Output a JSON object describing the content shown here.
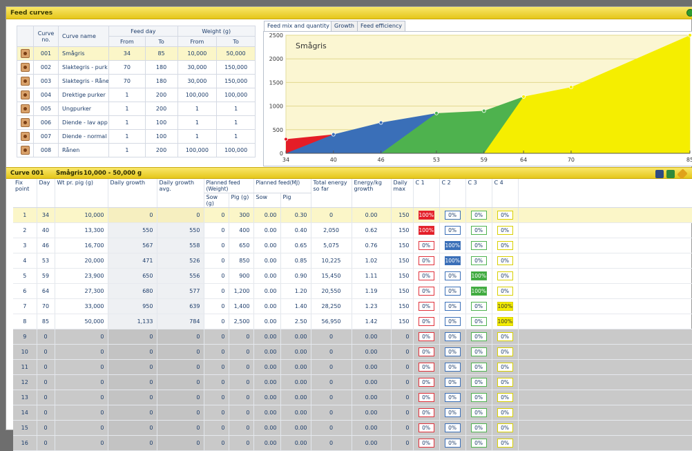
{
  "window": {
    "title": "Feed curves"
  },
  "curves_table": {
    "headers": {
      "curve_no": "Curve no.",
      "curve_name": "Curve name",
      "feed_day": "Feed day",
      "weight": "Weight (g)",
      "from": "From",
      "to": "To"
    },
    "rows": [
      {
        "no": "001",
        "name": "Smågris",
        "from_day": "34",
        "to_day": "85",
        "from_w": "10,000",
        "to_w": "50,000"
      },
      {
        "no": "002",
        "name": "Slaktegris - purk",
        "from_day": "70",
        "to_day": "180",
        "from_w": "30,000",
        "to_w": "150,000"
      },
      {
        "no": "003",
        "name": "Slaktegris - Råne",
        "from_day": "70",
        "to_day": "180",
        "from_w": "30,000",
        "to_w": "150,000"
      },
      {
        "no": "004",
        "name": "Drektige purker",
        "from_day": "1",
        "to_day": "200",
        "from_w": "100,000",
        "to_w": "100,000"
      },
      {
        "no": "005",
        "name": "Ungpurker",
        "from_day": "1",
        "to_day": "200",
        "from_w": "1",
        "to_w": "1"
      },
      {
        "no": "006",
        "name": "Diende - lav app",
        "from_day": "1",
        "to_day": "100",
        "from_w": "1",
        "to_w": "1"
      },
      {
        "no": "007",
        "name": "Diende - normal",
        "from_day": "1",
        "to_day": "100",
        "from_w": "1",
        "to_w": "1"
      },
      {
        "no": "008",
        "name": "Rånen",
        "from_day": "1",
        "to_day": "200",
        "from_w": "100,000",
        "to_w": "100,000"
      }
    ]
  },
  "tabs": [
    "Feed mix and quantity",
    "Growth",
    "Feed efficiency"
  ],
  "chart_data": {
    "type": "area",
    "title": "Smågris",
    "x_ticks": [
      "34",
      "40",
      "46",
      "53",
      "59",
      "64",
      "70",
      "85"
    ],
    "y_ticks": [
      "0",
      "500",
      "1000",
      "1500",
      "2000",
      "2500"
    ],
    "xlim": [
      34,
      85
    ],
    "ylim": [
      0,
      2500
    ],
    "x": [
      34,
      40,
      46,
      53,
      59,
      64,
      70,
      85
    ],
    "total": [
      300,
      400,
      650,
      850,
      900,
      1200,
      1400,
      2500
    ],
    "series": [
      {
        "values": [
          300,
          400,
          0,
          0,
          0,
          0,
          0,
          0
        ],
        "color": "#e41d27"
      },
      {
        "values": [
          0,
          400,
          650,
          850,
          0,
          0,
          0,
          0
        ],
        "color": "#3a6fb8"
      },
      {
        "values": [
          0,
          0,
          0,
          850,
          900,
          1200,
          0,
          0
        ],
        "color": "#4eb24e"
      },
      {
        "values": [
          0,
          0,
          0,
          0,
          0,
          1200,
          1400,
          2500
        ],
        "color": "#f5ee00"
      }
    ]
  },
  "section": {
    "curve_label": "Curve 001",
    "name": "Smågris",
    "range": "10,000 - 50,000 g"
  },
  "grid": {
    "headers": {
      "fix_point": "Fix point",
      "day": "Day",
      "wt": "Wt pr. pig (g)",
      "daily_growth": "Daily growth",
      "daily_growth_avg": "Daily growth avg.",
      "planned_weight": "Planned feed (Weight)",
      "sow_g": "Sow (g)",
      "pig_g": "Pig (g)",
      "planned_mj": "Planned feed(MJ)",
      "sow": "Sow",
      "pig": "Pig",
      "total_energy": "Total energy so far",
      "energy_kg": "Energy/kg growth",
      "daily_max": "Daily max",
      "c1": "C 1",
      "c2": "C 2",
      "c3": "C 3",
      "c4": "C 4"
    },
    "rows": [
      {
        "fp": "1",
        "day": "34",
        "wt": "10,000",
        "dg": "0",
        "dga": "0",
        "sowg": "0",
        "pigg": "300",
        "sowmj": "0.00",
        "pigmj": "0.30",
        "te": "0",
        "ekg": "0.00",
        "dmax": "150",
        "c": [
          "100%",
          "0%",
          "0%",
          "0%"
        ]
      },
      {
        "fp": "2",
        "day": "40",
        "wt": "13,300",
        "dg": "550",
        "dga": "550",
        "sowg": "0",
        "pigg": "400",
        "sowmj": "0.00",
        "pigmj": "0.40",
        "te": "2,050",
        "ekg": "0.62",
        "dmax": "150",
        "c": [
          "100%",
          "0%",
          "0%",
          "0%"
        ]
      },
      {
        "fp": "3",
        "day": "46",
        "wt": "16,700",
        "dg": "567",
        "dga": "558",
        "sowg": "0",
        "pigg": "650",
        "sowmj": "0.00",
        "pigmj": "0.65",
        "te": "5,075",
        "ekg": "0.76",
        "dmax": "150",
        "c": [
          "0%",
          "100%",
          "0%",
          "0%"
        ]
      },
      {
        "fp": "4",
        "day": "53",
        "wt": "20,000",
        "dg": "471",
        "dga": "526",
        "sowg": "0",
        "pigg": "850",
        "sowmj": "0.00",
        "pigmj": "0.85",
        "te": "10,225",
        "ekg": "1.02",
        "dmax": "150",
        "c": [
          "0%",
          "100%",
          "0%",
          "0%"
        ]
      },
      {
        "fp": "5",
        "day": "59",
        "wt": "23,900",
        "dg": "650",
        "dga": "556",
        "sowg": "0",
        "pigg": "900",
        "sowmj": "0.00",
        "pigmj": "0.90",
        "te": "15,450",
        "ekg": "1.11",
        "dmax": "150",
        "c": [
          "0%",
          "0%",
          "100%",
          "0%"
        ]
      },
      {
        "fp": "6",
        "day": "64",
        "wt": "27,300",
        "dg": "680",
        "dga": "577",
        "sowg": "0",
        "pigg": "1,200",
        "sowmj": "0.00",
        "pigmj": "1.20",
        "te": "20,550",
        "ekg": "1.19",
        "dmax": "150",
        "c": [
          "0%",
          "0%",
          "100%",
          "0%"
        ]
      },
      {
        "fp": "7",
        "day": "70",
        "wt": "33,000",
        "dg": "950",
        "dga": "639",
        "sowg": "0",
        "pigg": "1,400",
        "sowmj": "0.00",
        "pigmj": "1.40",
        "te": "28,250",
        "ekg": "1.23",
        "dmax": "150",
        "c": [
          "0%",
          "0%",
          "0%",
          "100%"
        ]
      },
      {
        "fp": "8",
        "day": "85",
        "wt": "50,000",
        "dg": "1,133",
        "dga": "784",
        "sowg": "0",
        "pigg": "2,500",
        "sowmj": "0.00",
        "pigmj": "2.50",
        "te": "56,950",
        "ekg": "1.42",
        "dmax": "150",
        "c": [
          "0%",
          "0%",
          "0%",
          "100%"
        ]
      },
      {
        "fp": "9",
        "day": "0",
        "wt": "0",
        "dg": "0",
        "dga": "0",
        "sowg": "0",
        "pigg": "0",
        "sowmj": "0.00",
        "pigmj": "0.00",
        "te": "0",
        "ekg": "0.00",
        "dmax": "0",
        "c": [
          "0%",
          "0%",
          "0%",
          "0%"
        ]
      },
      {
        "fp": "10",
        "day": "0",
        "wt": "0",
        "dg": "0",
        "dga": "0",
        "sowg": "0",
        "pigg": "0",
        "sowmj": "0.00",
        "pigmj": "0.00",
        "te": "0",
        "ekg": "0.00",
        "dmax": "0",
        "c": [
          "0%",
          "0%",
          "0%",
          "0%"
        ]
      },
      {
        "fp": "11",
        "day": "0",
        "wt": "0",
        "dg": "0",
        "dga": "0",
        "sowg": "0",
        "pigg": "0",
        "sowmj": "0.00",
        "pigmj": "0.00",
        "te": "0",
        "ekg": "0.00",
        "dmax": "0",
        "c": [
          "0%",
          "0%",
          "0%",
          "0%"
        ]
      },
      {
        "fp": "12",
        "day": "0",
        "wt": "0",
        "dg": "0",
        "dga": "0",
        "sowg": "0",
        "pigg": "0",
        "sowmj": "0.00",
        "pigmj": "0.00",
        "te": "0",
        "ekg": "0.00",
        "dmax": "0",
        "c": [
          "0%",
          "0%",
          "0%",
          "0%"
        ]
      },
      {
        "fp": "13",
        "day": "0",
        "wt": "0",
        "dg": "0",
        "dga": "0",
        "sowg": "0",
        "pigg": "0",
        "sowmj": "0.00",
        "pigmj": "0.00",
        "te": "0",
        "ekg": "0.00",
        "dmax": "0",
        "c": [
          "0%",
          "0%",
          "0%",
          "0%"
        ]
      },
      {
        "fp": "14",
        "day": "0",
        "wt": "0",
        "dg": "0",
        "dga": "0",
        "sowg": "0",
        "pigg": "0",
        "sowmj": "0.00",
        "pigmj": "0.00",
        "te": "0",
        "ekg": "0.00",
        "dmax": "0",
        "c": [
          "0%",
          "0%",
          "0%",
          "0%"
        ]
      },
      {
        "fp": "15",
        "day": "0",
        "wt": "0",
        "dg": "0",
        "dga": "0",
        "sowg": "0",
        "pigg": "0",
        "sowmj": "0.00",
        "pigmj": "0.00",
        "te": "0",
        "ekg": "0.00",
        "dmax": "0",
        "c": [
          "0%",
          "0%",
          "0%",
          "0%"
        ]
      },
      {
        "fp": "16",
        "day": "0",
        "wt": "0",
        "dg": "0",
        "dga": "0",
        "sowg": "0",
        "pigg": "0",
        "sowmj": "0.00",
        "pigmj": "0.00",
        "te": "0",
        "ekg": "0.00",
        "dmax": "0",
        "c": [
          "0%",
          "0%",
          "0%",
          "0%"
        ]
      }
    ]
  },
  "icons": {
    "curve_row": "gear-icon",
    "section_toolbar": [
      "download-icon",
      "save-icon",
      "pencil-icon"
    ],
    "title_bar": "status-circle-icon"
  }
}
